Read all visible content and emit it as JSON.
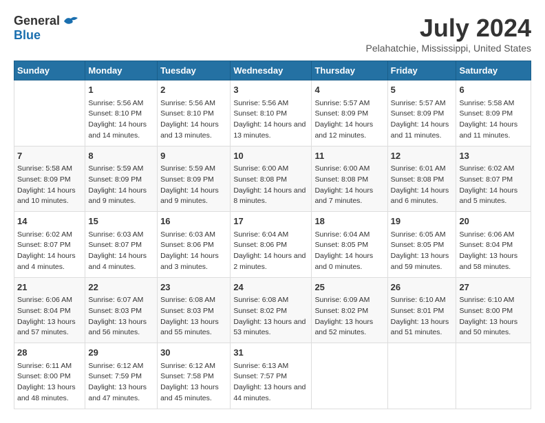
{
  "header": {
    "logo_general": "General",
    "logo_blue": "Blue",
    "month": "July 2024",
    "location": "Pelahatchie, Mississippi, United States"
  },
  "days_of_week": [
    "Sunday",
    "Monday",
    "Tuesday",
    "Wednesday",
    "Thursday",
    "Friday",
    "Saturday"
  ],
  "weeks": [
    [
      {
        "day": "",
        "sunrise": "",
        "sunset": "",
        "daylight": ""
      },
      {
        "day": "1",
        "sunrise": "Sunrise: 5:56 AM",
        "sunset": "Sunset: 8:10 PM",
        "daylight": "Daylight: 14 hours and 14 minutes."
      },
      {
        "day": "2",
        "sunrise": "Sunrise: 5:56 AM",
        "sunset": "Sunset: 8:10 PM",
        "daylight": "Daylight: 14 hours and 13 minutes."
      },
      {
        "day": "3",
        "sunrise": "Sunrise: 5:56 AM",
        "sunset": "Sunset: 8:10 PM",
        "daylight": "Daylight: 14 hours and 13 minutes."
      },
      {
        "day": "4",
        "sunrise": "Sunrise: 5:57 AM",
        "sunset": "Sunset: 8:09 PM",
        "daylight": "Daylight: 14 hours and 12 minutes."
      },
      {
        "day": "5",
        "sunrise": "Sunrise: 5:57 AM",
        "sunset": "Sunset: 8:09 PM",
        "daylight": "Daylight: 14 hours and 11 minutes."
      },
      {
        "day": "6",
        "sunrise": "Sunrise: 5:58 AM",
        "sunset": "Sunset: 8:09 PM",
        "daylight": "Daylight: 14 hours and 11 minutes."
      }
    ],
    [
      {
        "day": "7",
        "sunrise": "Sunrise: 5:58 AM",
        "sunset": "Sunset: 8:09 PM",
        "daylight": "Daylight: 14 hours and 10 minutes."
      },
      {
        "day": "8",
        "sunrise": "Sunrise: 5:59 AM",
        "sunset": "Sunset: 8:09 PM",
        "daylight": "Daylight: 14 hours and 9 minutes."
      },
      {
        "day": "9",
        "sunrise": "Sunrise: 5:59 AM",
        "sunset": "Sunset: 8:09 PM",
        "daylight": "Daylight: 14 hours and 9 minutes."
      },
      {
        "day": "10",
        "sunrise": "Sunrise: 6:00 AM",
        "sunset": "Sunset: 8:08 PM",
        "daylight": "Daylight: 14 hours and 8 minutes."
      },
      {
        "day": "11",
        "sunrise": "Sunrise: 6:00 AM",
        "sunset": "Sunset: 8:08 PM",
        "daylight": "Daylight: 14 hours and 7 minutes."
      },
      {
        "day": "12",
        "sunrise": "Sunrise: 6:01 AM",
        "sunset": "Sunset: 8:08 PM",
        "daylight": "Daylight: 14 hours and 6 minutes."
      },
      {
        "day": "13",
        "sunrise": "Sunrise: 6:02 AM",
        "sunset": "Sunset: 8:07 PM",
        "daylight": "Daylight: 14 hours and 5 minutes."
      }
    ],
    [
      {
        "day": "14",
        "sunrise": "Sunrise: 6:02 AM",
        "sunset": "Sunset: 8:07 PM",
        "daylight": "Daylight: 14 hours and 4 minutes."
      },
      {
        "day": "15",
        "sunrise": "Sunrise: 6:03 AM",
        "sunset": "Sunset: 8:07 PM",
        "daylight": "Daylight: 14 hours and 4 minutes."
      },
      {
        "day": "16",
        "sunrise": "Sunrise: 6:03 AM",
        "sunset": "Sunset: 8:06 PM",
        "daylight": "Daylight: 14 hours and 3 minutes."
      },
      {
        "day": "17",
        "sunrise": "Sunrise: 6:04 AM",
        "sunset": "Sunset: 8:06 PM",
        "daylight": "Daylight: 14 hours and 2 minutes."
      },
      {
        "day": "18",
        "sunrise": "Sunrise: 6:04 AM",
        "sunset": "Sunset: 8:05 PM",
        "daylight": "Daylight: 14 hours and 0 minutes."
      },
      {
        "day": "19",
        "sunrise": "Sunrise: 6:05 AM",
        "sunset": "Sunset: 8:05 PM",
        "daylight": "Daylight: 13 hours and 59 minutes."
      },
      {
        "day": "20",
        "sunrise": "Sunrise: 6:06 AM",
        "sunset": "Sunset: 8:04 PM",
        "daylight": "Daylight: 13 hours and 58 minutes."
      }
    ],
    [
      {
        "day": "21",
        "sunrise": "Sunrise: 6:06 AM",
        "sunset": "Sunset: 8:04 PM",
        "daylight": "Daylight: 13 hours and 57 minutes."
      },
      {
        "day": "22",
        "sunrise": "Sunrise: 6:07 AM",
        "sunset": "Sunset: 8:03 PM",
        "daylight": "Daylight: 13 hours and 56 minutes."
      },
      {
        "day": "23",
        "sunrise": "Sunrise: 6:08 AM",
        "sunset": "Sunset: 8:03 PM",
        "daylight": "Daylight: 13 hours and 55 minutes."
      },
      {
        "day": "24",
        "sunrise": "Sunrise: 6:08 AM",
        "sunset": "Sunset: 8:02 PM",
        "daylight": "Daylight: 13 hours and 53 minutes."
      },
      {
        "day": "25",
        "sunrise": "Sunrise: 6:09 AM",
        "sunset": "Sunset: 8:02 PM",
        "daylight": "Daylight: 13 hours and 52 minutes."
      },
      {
        "day": "26",
        "sunrise": "Sunrise: 6:10 AM",
        "sunset": "Sunset: 8:01 PM",
        "daylight": "Daylight: 13 hours and 51 minutes."
      },
      {
        "day": "27",
        "sunrise": "Sunrise: 6:10 AM",
        "sunset": "Sunset: 8:00 PM",
        "daylight": "Daylight: 13 hours and 50 minutes."
      }
    ],
    [
      {
        "day": "28",
        "sunrise": "Sunrise: 6:11 AM",
        "sunset": "Sunset: 8:00 PM",
        "daylight": "Daylight: 13 hours and 48 minutes."
      },
      {
        "day": "29",
        "sunrise": "Sunrise: 6:12 AM",
        "sunset": "Sunset: 7:59 PM",
        "daylight": "Daylight: 13 hours and 47 minutes."
      },
      {
        "day": "30",
        "sunrise": "Sunrise: 6:12 AM",
        "sunset": "Sunset: 7:58 PM",
        "daylight": "Daylight: 13 hours and 45 minutes."
      },
      {
        "day": "31",
        "sunrise": "Sunrise: 6:13 AM",
        "sunset": "Sunset: 7:57 PM",
        "daylight": "Daylight: 13 hours and 44 minutes."
      },
      {
        "day": "",
        "sunrise": "",
        "sunset": "",
        "daylight": ""
      },
      {
        "day": "",
        "sunrise": "",
        "sunset": "",
        "daylight": ""
      },
      {
        "day": "",
        "sunrise": "",
        "sunset": "",
        "daylight": ""
      }
    ]
  ]
}
